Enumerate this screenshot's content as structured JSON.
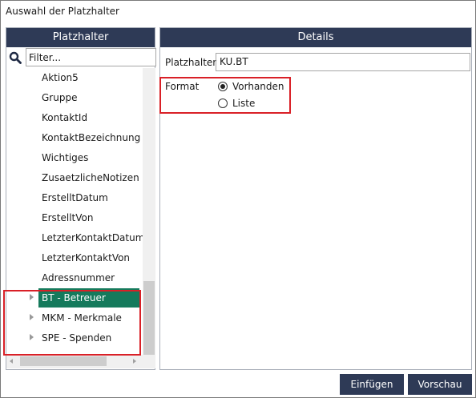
{
  "window": {
    "title": "Auswahl der Platzhalter"
  },
  "left": {
    "header": "Platzhalter",
    "search": {
      "icon": "search-icon",
      "placeholder": "Filter..."
    },
    "items": [
      {
        "label": "Aktion5",
        "expandable": false
      },
      {
        "label": "Gruppe",
        "expandable": false
      },
      {
        "label": "KontaktId",
        "expandable": false
      },
      {
        "label": "KontaktBezeichnung",
        "expandable": false
      },
      {
        "label": "Wichtiges",
        "expandable": false
      },
      {
        "label": "ZusaetzlicheNotizen",
        "expandable": false
      },
      {
        "label": "ErstelltDatum",
        "expandable": false
      },
      {
        "label": "ErstelltVon",
        "expandable": false
      },
      {
        "label": "LetzterKontaktDatum",
        "expandable": false
      },
      {
        "label": "LetzterKontaktVon",
        "expandable": false
      },
      {
        "label": "Adressnummer",
        "expandable": false
      },
      {
        "label": "BT - Betreuer",
        "expandable": true,
        "selected": true
      },
      {
        "label": "MKM - Merkmale",
        "expandable": true
      },
      {
        "label": "SPE - Spenden",
        "expandable": true
      }
    ]
  },
  "details": {
    "header": "Details",
    "placeholder_label": "Platzhalter",
    "placeholder_value": "KU.BT",
    "format_label": "Format",
    "format_options": [
      {
        "label": "Vorhanden",
        "checked": true
      },
      {
        "label": "Liste",
        "checked": false
      }
    ]
  },
  "buttons": {
    "insert": "Einfügen",
    "preview": "Vorschau"
  },
  "colors": {
    "header_bg": "#2e3a56",
    "selected_bg": "#157a5c",
    "highlight": "#d92027"
  }
}
